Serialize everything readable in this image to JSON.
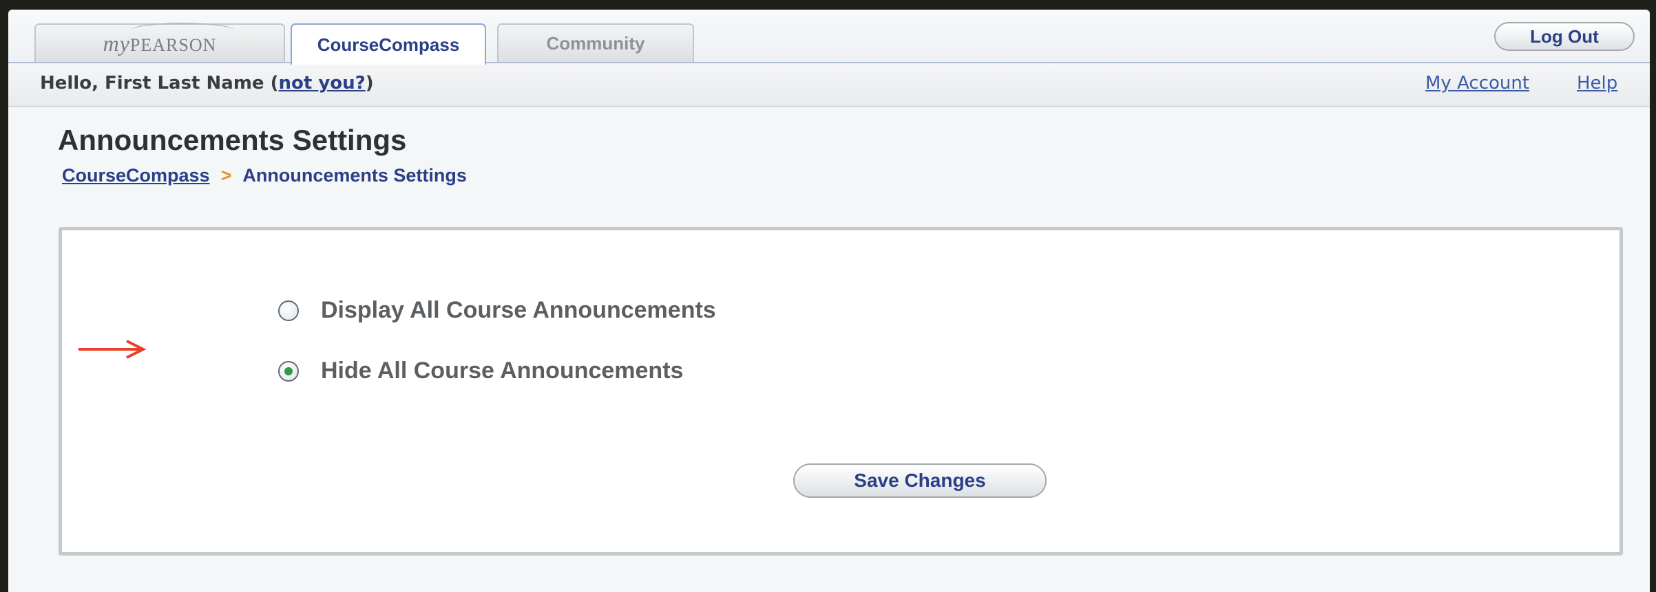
{
  "tabs": {
    "mypearson": {
      "my": "my",
      "pearson": "PEARSON"
    },
    "coursecompass": "CourseCompass",
    "community": "Community"
  },
  "header": {
    "logout_label": "Log Out"
  },
  "userbar": {
    "greeting": "Hello, First Last Name (",
    "not_you": "not you?",
    "greeting_end": ")",
    "my_account": "My Account",
    "help": "Help"
  },
  "page": {
    "title": "Announcements Settings",
    "breadcrumb": {
      "root": "CourseCompass",
      "separator": ">",
      "current": "Announcements Settings"
    }
  },
  "settings": {
    "options": [
      {
        "label": "Display All Course Announcements",
        "selected": false
      },
      {
        "label": "Hide All Course Announcements",
        "selected": true
      }
    ],
    "save_label": "Save Changes"
  },
  "colors": {
    "link": "#2b3f87",
    "arrow": "#e8402c",
    "radio_selected": "#2f9a3f"
  }
}
